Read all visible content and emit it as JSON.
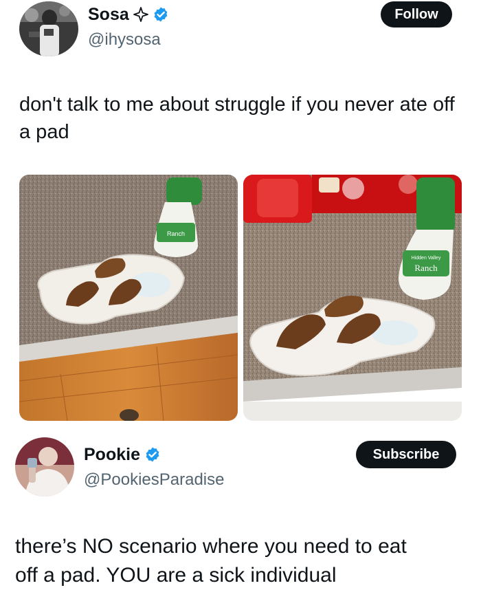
{
  "tweet1": {
    "display_name": "Sosa",
    "handle": "@ihysosa",
    "follow_label": "Follow",
    "text": "don't talk to me about struggle if you never ate off a pad",
    "badge_icon": "sparkle-outline-icon",
    "verified_icon": "verified-badge-icon",
    "photos": [
      {
        "name": "photo-pad-wings-on-counter-left",
        "ranch_label": "Ranch"
      },
      {
        "name": "photo-pad-wings-on-counter-right",
        "ranch_label": "Ranch",
        "ranch_brand": "Hidden Valley"
      }
    ]
  },
  "tweet2": {
    "display_name": "Pookie",
    "handle": "@PookiesParadise",
    "subscribe_label": "Subscribe",
    "verified_icon": "verified-badge-icon",
    "text_line1": "there’s NO scenario where you need to eat",
    "text_line2": "off a pad. YOU are a sick individual"
  },
  "colors": {
    "verified_blue": "#1d9bf0",
    "button_bg": "#0f1419",
    "handle_gray": "#536471"
  }
}
